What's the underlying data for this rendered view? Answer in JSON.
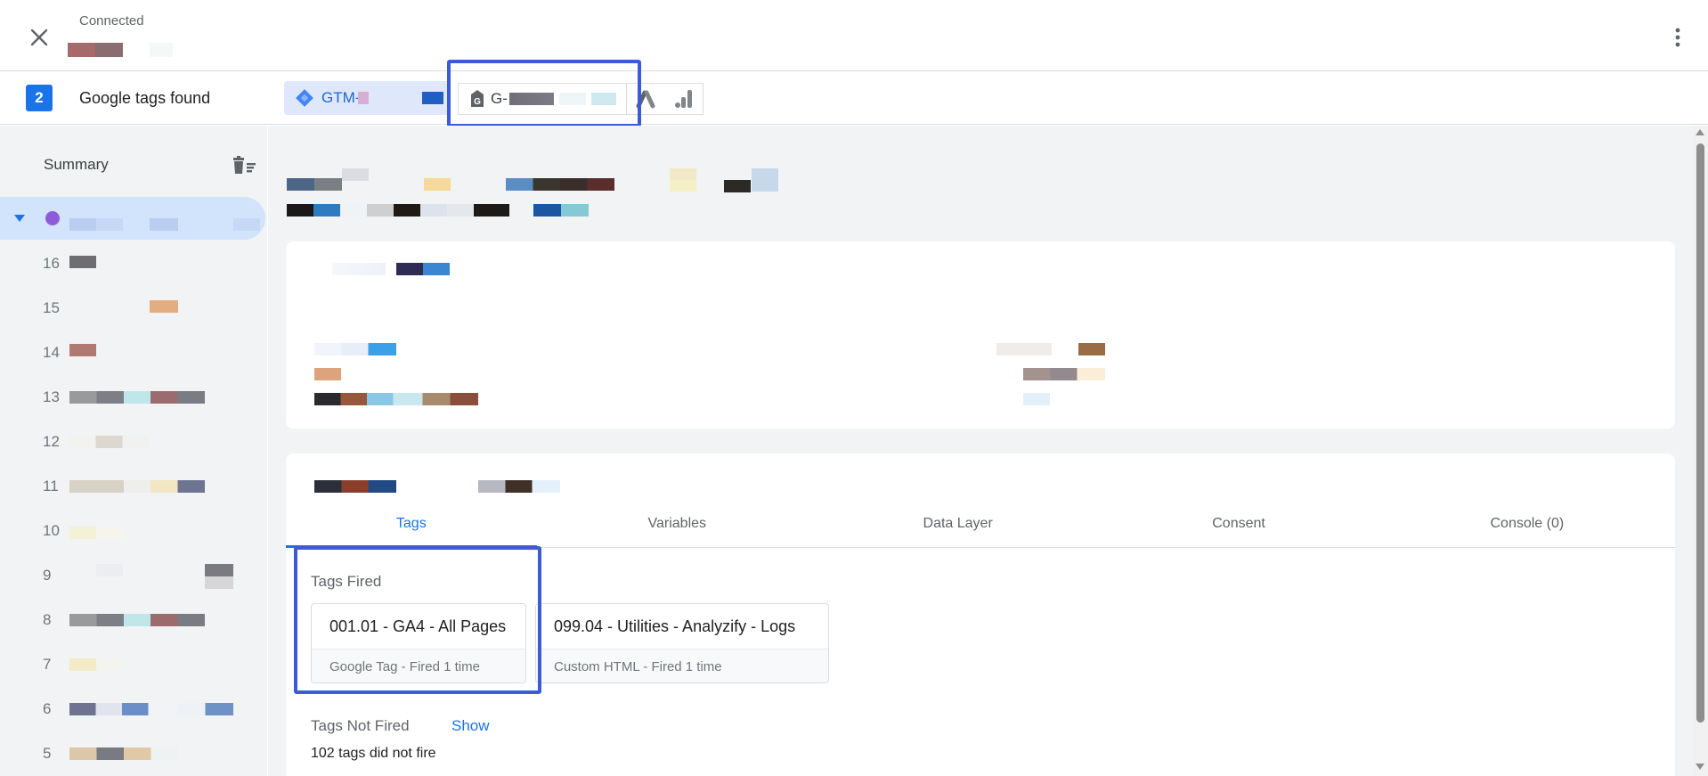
{
  "header": {
    "status_label": "Connected"
  },
  "tagbar": {
    "count": "2",
    "found_label": "Google tags found",
    "gtm_chip_label": "GTM-",
    "g_chip_label": "G-"
  },
  "sidebar": {
    "summary_label": "Summary",
    "event_numbers": [
      "16",
      "15",
      "14",
      "13",
      "12",
      "11",
      "10",
      "9",
      "8",
      "7",
      "6",
      "5"
    ]
  },
  "main": {
    "tabs": [
      {
        "label": "Tags",
        "active": true
      },
      {
        "label": "Variables",
        "active": false
      },
      {
        "label": "Data Layer",
        "active": false
      },
      {
        "label": "Consent",
        "active": false
      },
      {
        "label": "Console (0)",
        "active": false
      }
    ],
    "tags_fired_label": "Tags Fired",
    "fired_tags": [
      {
        "name": "001.01 - GA4 - All Pages",
        "detail": "Google Tag - Fired 1 time"
      },
      {
        "name": "099.04 - Utilities - Analyzify - Logs",
        "detail": "Custom HTML - Fired 1 time"
      }
    ],
    "tags_not_fired_label": "Tags Not Fired",
    "show_label": "Show",
    "did_not_fire_text": "102 tags did not fire"
  },
  "colors": {
    "accent": "#1a73e8",
    "highlight": "#3b5bd9",
    "active_item_bg": "#d2e3fc"
  }
}
